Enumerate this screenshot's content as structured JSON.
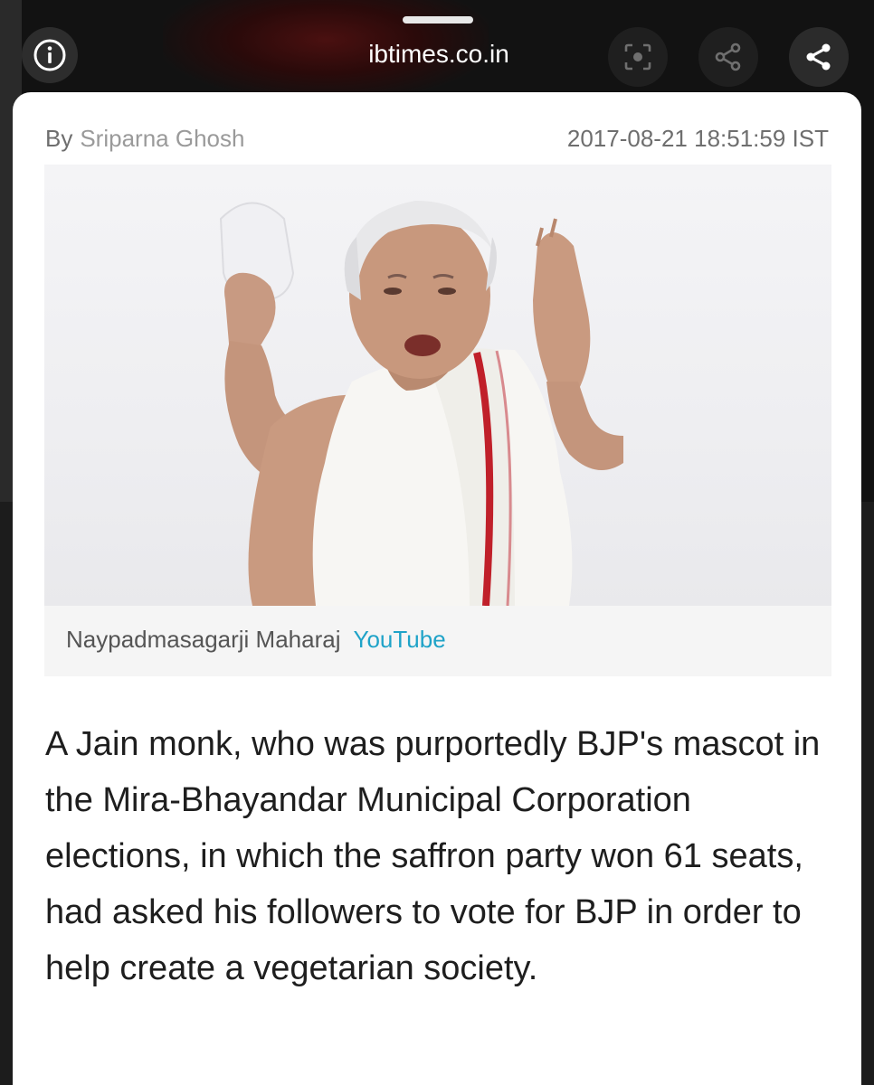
{
  "toolbar": {
    "url": "ibtimes.co.in",
    "info_icon": "info-icon",
    "lens_icon": "lens-icon",
    "share_icon": "share-icon"
  },
  "article": {
    "by_label": "By",
    "author": "Sriparna Ghosh",
    "timestamp": "2017-08-21 18:51:59 IST",
    "image_caption": "Naypadmasagarji Maharaj",
    "image_source": "YouTube",
    "body": "A Jain monk, who was purportedly BJP's mascot in the Mira-Bhayandar Municipal Corporation elections, in which the saffron party won 61 seats, had asked his followers to vote for BJP in order to help create a vegetarian society."
  },
  "colors": {
    "source_link": "#1fa3c8",
    "robe_stripe": "#c0202a"
  }
}
